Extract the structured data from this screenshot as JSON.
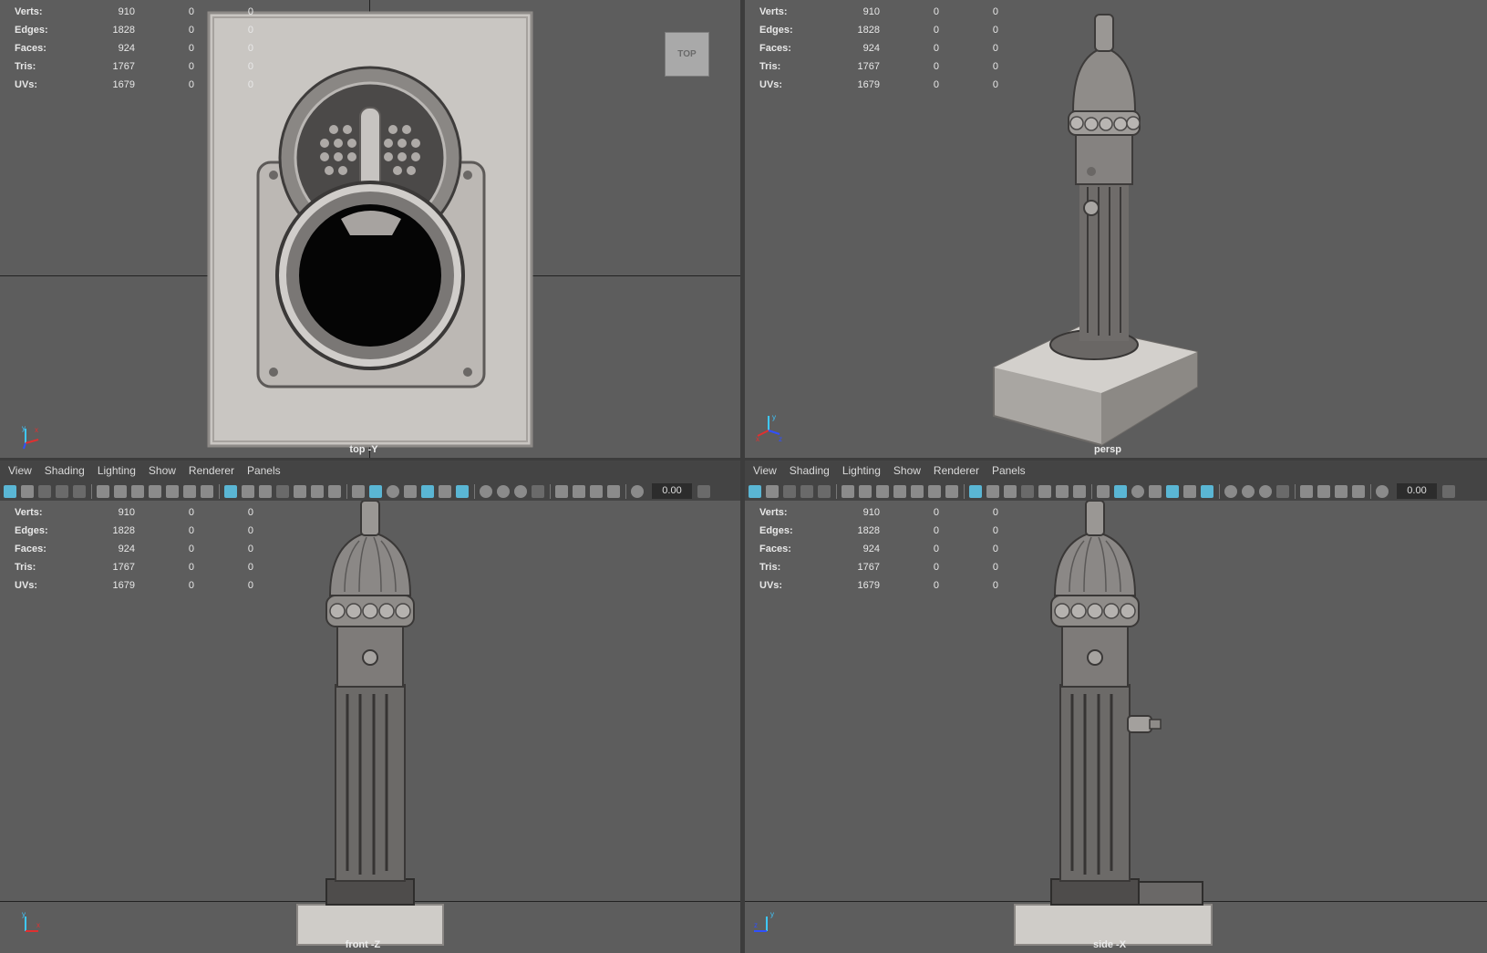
{
  "stats": {
    "rows": [
      {
        "label": "Verts:",
        "value": "910",
        "c1": "0",
        "c2": "0"
      },
      {
        "label": "Edges:",
        "value": "1828",
        "c1": "0",
        "c2": "0"
      },
      {
        "label": "Faces:",
        "value": "924",
        "c1": "0",
        "c2": "0"
      },
      {
        "label": "Tris:",
        "value": "1767",
        "c1": "0",
        "c2": "0"
      },
      {
        "label": "UVs:",
        "value": "1679",
        "c1": "0",
        "c2": "0"
      }
    ]
  },
  "viewports": {
    "top": {
      "camera": "top -Y",
      "cube_label": "TOP"
    },
    "persp": {
      "camera": "persp"
    },
    "front": {
      "camera": "front -Z"
    },
    "side": {
      "camera": "side -X"
    }
  },
  "menu": [
    "View",
    "Shading",
    "Lighting",
    "Show",
    "Renderer",
    "Panels"
  ],
  "toolbar": {
    "exposure_value": "0.00"
  },
  "axis_labels": {
    "x": "x",
    "y": "y",
    "z": "z"
  },
  "colors": {
    "viewport_bg": "#5d5d5d",
    "panel_bg": "#444444",
    "accent": "#5ab6d4"
  }
}
